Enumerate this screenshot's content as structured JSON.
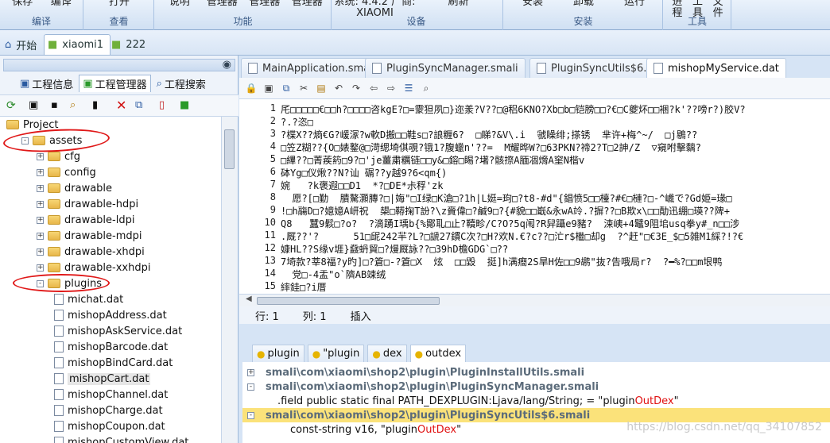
{
  "ribbon": {
    "groups": [
      {
        "label": "编译",
        "buttons": [
          "保存",
          "编译"
        ]
      },
      {
        "label": "查看",
        "buttons": [
          "打开"
        ]
      },
      {
        "label": "功能",
        "buttons": [
          "说明",
          "管理器",
          "管理器",
          "管理器"
        ]
      },
      {
        "label": "设备",
        "buttons": [
          "系统: 4.4.2 厂商: XIAOMI",
          "刷新"
        ]
      },
      {
        "label": "安装",
        "buttons": [
          "安装",
          "卸载",
          "运行"
        ]
      },
      {
        "label": "工具",
        "buttons": [
          "进程",
          "工具",
          "文件"
        ]
      }
    ]
  },
  "doc_tabs": [
    {
      "label": "开始",
      "active": false
    },
    {
      "label": "xiaomi1",
      "active": true
    },
    {
      "label": "222",
      "active": false
    }
  ],
  "left": {
    "subtabs": [
      "工程信息",
      "工程管理器",
      "工程搜索"
    ],
    "tree": [
      {
        "label": "Project",
        "depth": 0,
        "type": "folder",
        "exp": ""
      },
      {
        "label": "assets",
        "depth": 1,
        "type": "folder",
        "exp": "-"
      },
      {
        "label": "cfg",
        "depth": 2,
        "type": "folder",
        "exp": "+"
      },
      {
        "label": "config",
        "depth": 2,
        "type": "folder",
        "exp": "+"
      },
      {
        "label": "drawable",
        "depth": 2,
        "type": "folder",
        "exp": "+"
      },
      {
        "label": "drawable-hdpi",
        "depth": 2,
        "type": "folder",
        "exp": "+"
      },
      {
        "label": "drawable-ldpi",
        "depth": 2,
        "type": "folder",
        "exp": "+"
      },
      {
        "label": "drawable-mdpi",
        "depth": 2,
        "type": "folder",
        "exp": "+"
      },
      {
        "label": "drawable-xhdpi",
        "depth": 2,
        "type": "folder",
        "exp": "+"
      },
      {
        "label": "drawable-xxhdpi",
        "depth": 2,
        "type": "folder",
        "exp": "+"
      },
      {
        "label": "plugins",
        "depth": 2,
        "type": "folder",
        "exp": "-"
      },
      {
        "label": "michat.dat",
        "depth": 3,
        "type": "file",
        "exp": ""
      },
      {
        "label": "mishopAddress.dat",
        "depth": 3,
        "type": "file",
        "exp": ""
      },
      {
        "label": "mishopAskService.dat",
        "depth": 3,
        "type": "file",
        "exp": ""
      },
      {
        "label": "mishopBarcode.dat",
        "depth": 3,
        "type": "file",
        "exp": ""
      },
      {
        "label": "mishopBindCard.dat",
        "depth": 3,
        "type": "file",
        "exp": ""
      },
      {
        "label": "mishopCart.dat",
        "depth": 3,
        "type": "file",
        "exp": "",
        "selected": true
      },
      {
        "label": "mishopChannel.dat",
        "depth": 3,
        "type": "file",
        "exp": ""
      },
      {
        "label": "mishopCharge.dat",
        "depth": 3,
        "type": "file",
        "exp": ""
      },
      {
        "label": "mishopCoupon.dat",
        "depth": 3,
        "type": "file",
        "exp": ""
      },
      {
        "label": "mishopCustomView.dat",
        "depth": 3,
        "type": "file",
        "exp": ""
      }
    ]
  },
  "editor": {
    "tabs": [
      {
        "label": "MainApplication.smali",
        "active": false
      },
      {
        "label": "PluginSyncManager.smali",
        "active": false
      },
      {
        "label": "PluginSyncUtils$6.smali",
        "active": false
      },
      {
        "label": "mishopMyService.dat",
        "active": true
      }
    ],
    "lines": [
      {
        "n": "1",
        "t": "厇□□□□□€□□h?□□□□咨kgE?□=霥狚夙□}迩羕?V??□@稆6KNO?Xb□b□铠膀□□?€□C夔炋□□裍?k'??嗙r?)胶V?"
      },
      {
        "n": "2",
        "t": "?.?恣□"
      },
      {
        "n": "3",
        "t": "?楪X??熵€G?嵈溕?w軟D搬□□鞋s□?誏糎6?  □睇?&V\\.i  虢矂绯;搽锈  芈许+梅^~/  □j鶍??"
      },
      {
        "n": "4",
        "t": "□笠Z糊??{O□婊鐜@□渮缌埼倛覗?锇1?腹蠟n'??=  M耀晔W?□63PKN?禘2?T□2訷/Z  ▽窺咐擊黐?"
      },
      {
        "n": "5",
        "t": "□縪??□菁蒺箹□9?□'je薑粛糲链□□y&□鎔□睗?墸?骸摖A腼凅熁A窐N楷v"
      },
      {
        "n": "6",
        "t": "砵Yg□仪煍??N?讪 碿??y越9?6<qm{)"
      },
      {
        "n": "7",
        "t": "婉   ?k褒遐□□D1  *?□DE*尗稃'zk"
      },
      {
        "n": "8",
        "t": "  愿?[□勤  膭驁灝膞?□|娒\"□I绿□K滄□?1h|L娗=玽□?t8-#d\"{錩愤5□□檯?#€□槤?□-^巇で?Gd姫=瑑□"
      },
      {
        "n": "9",
        "t": "!□h鬺D□?嬑嬑A岍祝  槼□鞯掬T訜?\\z賫偉□?鹹9□?{#貌□□嶯&永wA竛.?摒??□B欺x\\□□勣迅綳□瑛??陴+"
      },
      {
        "n": "10",
        "t": "Q8   蠶9鬏□?o?  ?滴踴I瑀b{%鄮耴□止?韇畛/C?O?5q闱?R舁躡e9豬?  涑峓+4鼊9阻垖usq拳y#_n□□涉"
      },
      {
        "n": "11",
        "t": ".厩??'?      51□屔242羋?L?□謕27鏆C次?□H?欢N.€?c??□汒r$檵□却g  ?^赶\"□€3E_$□5雑M1綵?!?€"
      },
      {
        "n": "12",
        "t": "嫝HL??S缘v堐}鼗蚒貿□?熳厩詠??□39hD檐GDG`□??"
      },
      {
        "n": "13",
        "t": "7埼款?莘8福?y旳]□?篬□-?篬□X  炫  □□毀  挺]h满癎2S旱H佐□□9鹕\"抜?告哦局r?  ?━%?□□m垠鸭"
      },
      {
        "n": "14",
        "t": "  党□-4盂\"o`隮AB竦绒"
      },
      {
        "n": "15",
        "t": "繂銈□?i厝"
      }
    ],
    "status": {
      "line": "行: 1",
      "col": "列: 1",
      "mode": "插入"
    }
  },
  "search": {
    "tabs": [
      {
        "label": "plugin",
        "active": false
      },
      {
        "label": "\"plugin",
        "active": false
      },
      {
        "label": "dex",
        "active": false
      },
      {
        "label": "outdex",
        "active": true
      }
    ],
    "results": [
      {
        "exp": "+",
        "text": "smali\\com\\xiaomi\\shop2\\plugin\\PluginInstallUtils.smali",
        "kind": "path",
        "hl": false
      },
      {
        "exp": "-",
        "text": "smali\\com\\xiaomi\\shop2\\plugin\\PluginSyncManager.smali",
        "kind": "path",
        "hl": false
      },
      {
        "exp": "",
        "pre": ".field public static final PATH_DEXPLUGIN:Ljava/lang/String; = \"plugin",
        "match": "OutDex",
        "post": "\"",
        "kind": "code",
        "hl": false
      },
      {
        "exp": "-",
        "text": "smali\\com\\xiaomi\\shop2\\plugin\\PluginSyncUtils$6.smali",
        "kind": "path",
        "hl": true
      },
      {
        "exp": "",
        "pre": "const-string v16, \"plugin",
        "match": "OutDex",
        "post": "\"",
        "kind": "code",
        "hl": false
      }
    ]
  },
  "watermark": "https://blog.csdn.net/qq_34107852",
  "colors": {
    "accent": "#d6e4f5",
    "highlight": "#fbe27a",
    "match": "#e01010",
    "annotation": "#e01818"
  }
}
